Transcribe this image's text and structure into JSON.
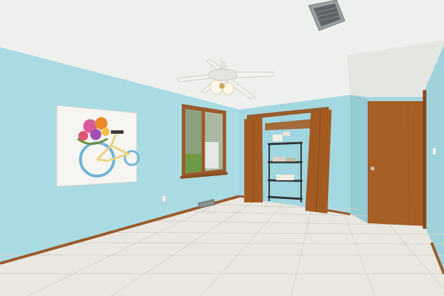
{
  "scene": {
    "description_type": "photo",
    "colors": {
      "wall_blue": "#a9dbe3",
      "wall_blue_shade": "#9ccfd8",
      "ceiling": "#eef0ee",
      "floor_tile": "#e9e7e0",
      "floor_grout": "#d4d2ca",
      "wood_trim": "#9a5a2c",
      "door_wood": "#a35b22",
      "door_wood_dark": "#86461a"
    },
    "objects": {
      "ceiling_fan": "ceiling-fan",
      "ceiling_vent": "ceiling-vent",
      "artwork": "bicycle-flower-painting",
      "window": "window",
      "closet": "closet-with-shelf",
      "door": "interior-door",
      "floor_vent": "floor-vent",
      "outlet": "wall-outlet"
    }
  }
}
